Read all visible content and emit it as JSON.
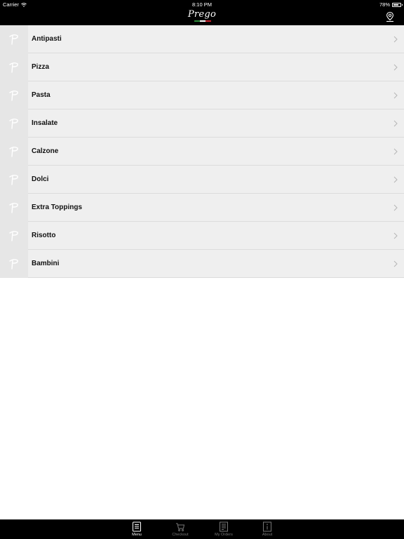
{
  "status_bar": {
    "carrier": "Carrier",
    "time": "8:10 PM",
    "battery": "78%",
    "battery_level": 0.78
  },
  "nav_bar": {
    "logo_text": "Prego",
    "right_icon": "location-pin-icon"
  },
  "menu": {
    "items": [
      {
        "label": "Antipasti"
      },
      {
        "label": "Pizza"
      },
      {
        "label": "Pasta"
      },
      {
        "label": "Insalate"
      },
      {
        "label": "Calzone"
      },
      {
        "label": "Dolci"
      },
      {
        "label": "Extra Toppings"
      },
      {
        "label": "Risotto"
      },
      {
        "label": "Bambini"
      }
    ]
  },
  "tab_bar": {
    "tabs": [
      {
        "label": "Menu",
        "icon": "menu-book-icon",
        "active": true
      },
      {
        "label": "Checkout",
        "icon": "cart-icon",
        "active": false
      },
      {
        "label": "My Orders",
        "icon": "orders-icon",
        "active": false
      },
      {
        "label": "About",
        "icon": "info-icon",
        "active": false
      }
    ]
  }
}
